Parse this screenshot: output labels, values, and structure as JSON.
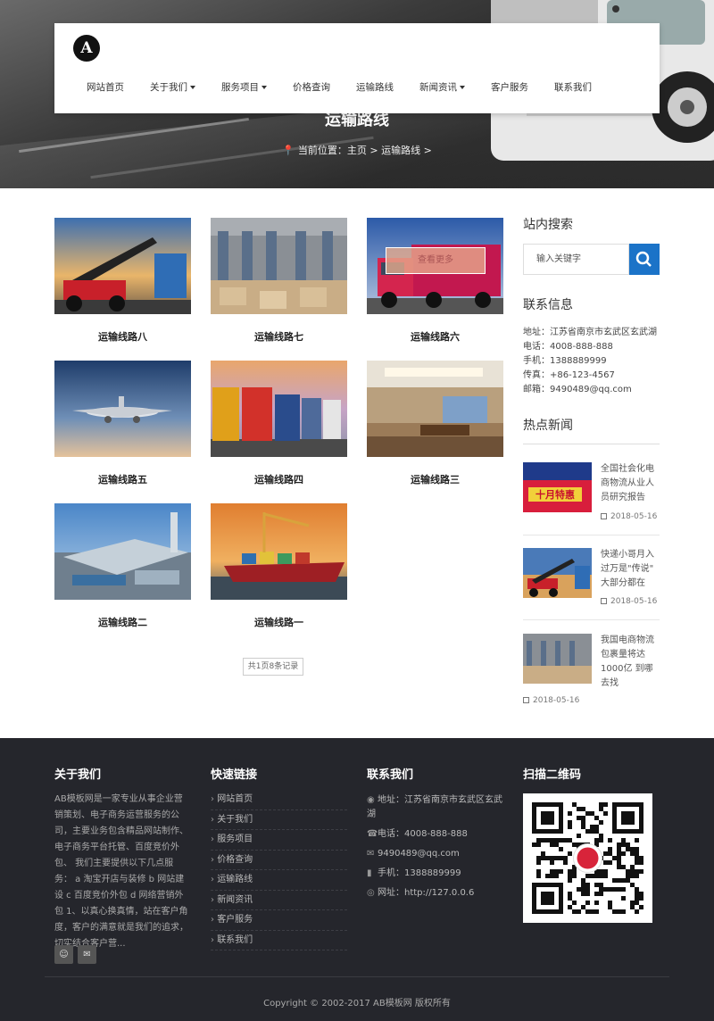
{
  "header": {
    "logo_letter": "A",
    "nav": [
      {
        "label": "网站首页",
        "dropdown": false
      },
      {
        "label": "关于我们",
        "dropdown": true
      },
      {
        "label": "服务项目",
        "dropdown": true
      },
      {
        "label": "价格查询",
        "dropdown": false
      },
      {
        "label": "运输路线",
        "dropdown": false
      },
      {
        "label": "新闻资讯",
        "dropdown": true
      },
      {
        "label": "客户服务",
        "dropdown": false
      },
      {
        "label": "联系我们",
        "dropdown": false
      }
    ]
  },
  "hero": {
    "title": "运输路线",
    "crumb_prefix": "当前位置：",
    "crumb_home": "主页",
    "crumb_sep1": " > ",
    "crumb_current": "运输路线",
    "crumb_sep2": " >"
  },
  "grid": {
    "items": [
      {
        "label": "运输线路八",
        "image": "container-loader"
      },
      {
        "label": "运输线路七",
        "image": "warehouse-boxes"
      },
      {
        "label": "运输线路六",
        "image": "red-truck"
      },
      {
        "label": "运输线路五",
        "image": "airplane"
      },
      {
        "label": "运输线路四",
        "image": "truck-fleet"
      },
      {
        "label": "运输线路三",
        "image": "office"
      },
      {
        "label": "运输线路二",
        "image": "logistics-park"
      },
      {
        "label": "运输线路一",
        "image": "cargo-ship"
      }
    ],
    "hover_label": "查看更多",
    "pager": "共1页8条记录"
  },
  "sidebar": {
    "search_title": "站内搜索",
    "search_placeholder": "输入关键字",
    "contact_title": "联系信息",
    "contact_lines": [
      "地址：江苏省南京市玄武区玄武湖",
      "电话：4008-888-888",
      "手机：1388889999",
      "传真：+86-123-4567",
      "邮箱：9490489@qq.com"
    ],
    "hot_title": "热点新闻",
    "hot_news": [
      {
        "title": "全国社会化电商物流从业人员研究报告",
        "date": "2018-05-16",
        "image": "promo-banner",
        "banner_text": "十月特惠"
      },
      {
        "title": "快递小哥月入过万是\"传说\" 大部分都在",
        "date": "2018-05-16",
        "image": "container-loader"
      },
      {
        "title": "我国电商物流包裹量将达1000亿 到哪去找",
        "date": "2018-05-16",
        "image": "warehouse-boxes"
      }
    ]
  },
  "footer": {
    "about_title": "关于我们",
    "about_text": "AB模板网是一家专业从事企业营销策划、电子商务运营服务的公司，主要业务包含精品网站制作、电子商务平台托管、百度竞价外包、 我们主要提供以下几点服务： a 淘宝开店与装修 b 网站建设 c 百度竞价外包 d 网络营销外包 1、以真心换真情，站在客户角度，客户的满意就是我们的追求，切实结合客户营...",
    "links_title": "快速链接",
    "links": [
      "网站首页",
      "关于我们",
      "服务项目",
      "价格查询",
      "运输路线",
      "新闻资讯",
      "客户服务",
      "联系我们"
    ],
    "contact_title": "联系我们",
    "contact": [
      {
        "icon": "location-icon",
        "text": "地址：江苏省南京市玄武区玄武湖"
      },
      {
        "icon": "phone-icon",
        "text": "电话：4008-888-888"
      },
      {
        "icon": "mail-icon",
        "text": "9490489@qq.com"
      },
      {
        "icon": "mobile-icon",
        "text": "手机：1388889999"
      },
      {
        "icon": "globe-icon",
        "text": "网址：http://127.0.0.6"
      }
    ],
    "qr_title": "扫描二维码",
    "copyright": "Copyright © 2002-2017 AB模板网 版权所有"
  }
}
